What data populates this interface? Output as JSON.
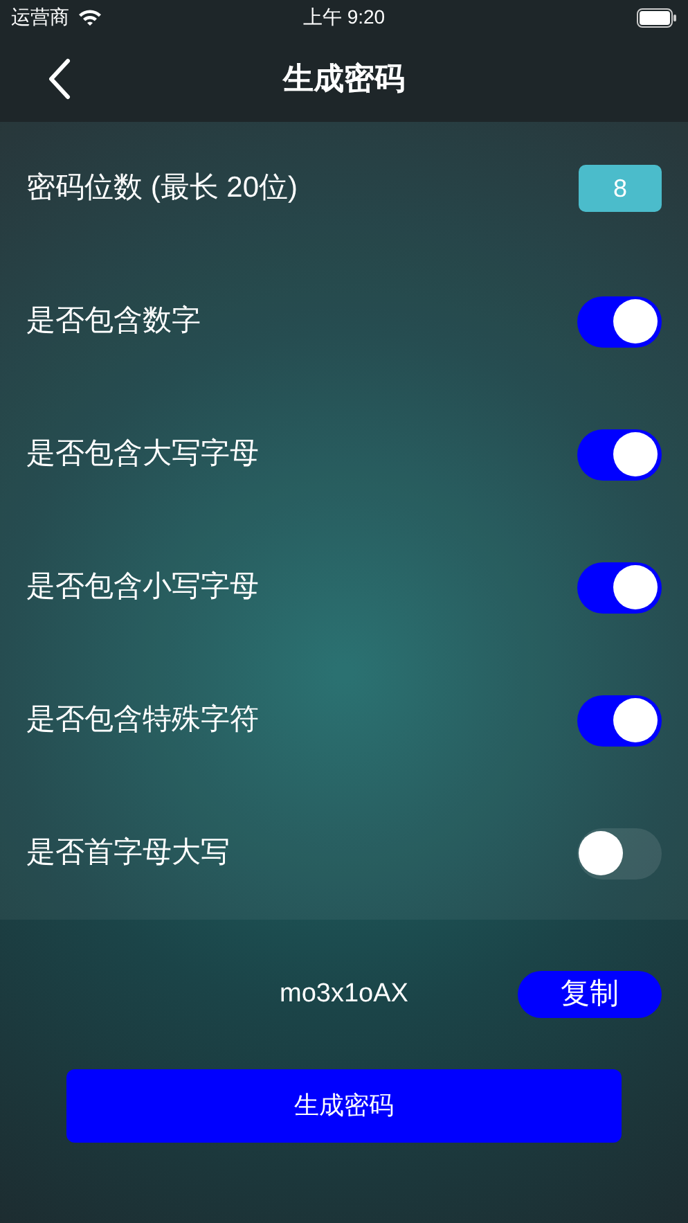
{
  "status_bar": {
    "carrier": "运营商",
    "time": "上午 9:20"
  },
  "nav": {
    "title": "生成密码"
  },
  "settings": [
    {
      "kind": "number",
      "label": "密码位数 (最长 20位)",
      "value": "8"
    },
    {
      "kind": "toggle",
      "label": "是否包含数字",
      "on": true
    },
    {
      "kind": "toggle",
      "label": "是否包含大写字母",
      "on": true
    },
    {
      "kind": "toggle",
      "label": "是否包含小写字母",
      "on": true
    },
    {
      "kind": "toggle",
      "label": "是否包含特殊字符",
      "on": true
    },
    {
      "kind": "toggle",
      "label": "是否首字母大写",
      "on": false
    }
  ],
  "result": {
    "password": "mo3x1oAX",
    "copy_button": "复制"
  },
  "generate_button": "生成密码"
}
